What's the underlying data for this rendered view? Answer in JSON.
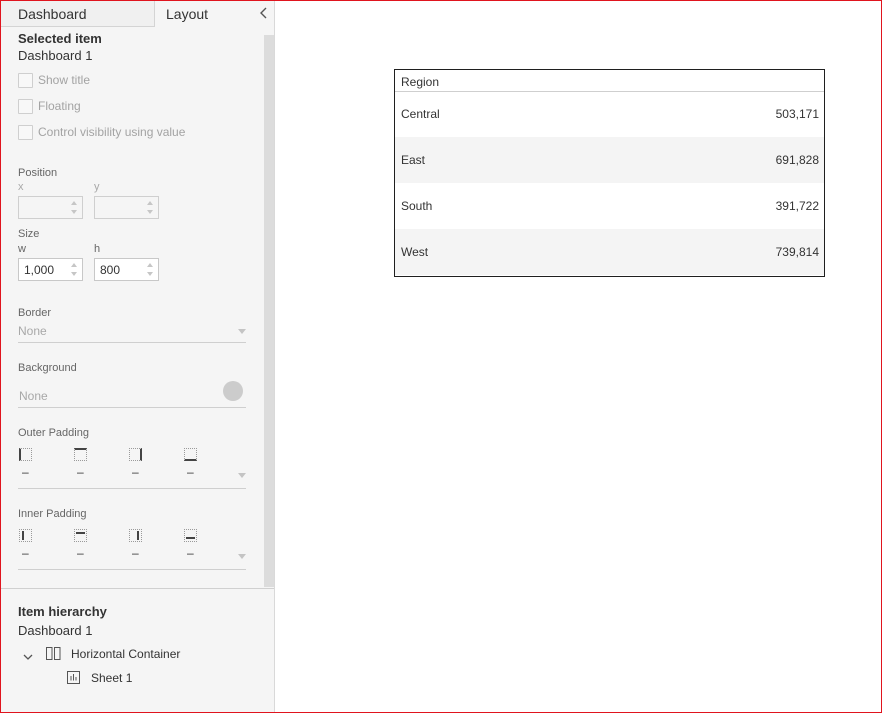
{
  "tabs": {
    "dashboard": "Dashboard",
    "layout": "Layout"
  },
  "selected_item": {
    "title": "Selected item",
    "name": "Dashboard 1",
    "checkboxes": [
      "Show title",
      "Floating",
      "Control visibility using value"
    ]
  },
  "position": {
    "label": "Position",
    "x_label": "x",
    "y_label": "y",
    "x_value": "",
    "y_value": ""
  },
  "size": {
    "label": "Size",
    "w_label": "w",
    "h_label": "h",
    "w_value": "1,000",
    "h_value": "800"
  },
  "border": {
    "label": "Border",
    "value": "None"
  },
  "background": {
    "label": "Background",
    "value": "None",
    "swatch_color": "#cccccc"
  },
  "outer_padding": {
    "label": "Outer Padding",
    "values": [
      "–",
      "–",
      "–",
      "–"
    ]
  },
  "inner_padding": {
    "label": "Inner Padding",
    "values": [
      "–",
      "–",
      "–",
      "–"
    ]
  },
  "item_hierarchy": {
    "title": "Item hierarchy",
    "root": "Dashboard 1",
    "container": "Horizontal Container",
    "sheet": "Sheet 1"
  },
  "table": {
    "header": "Region",
    "rows": [
      {
        "region": "Central",
        "value": "503,171"
      },
      {
        "region": "East",
        "value": "691,828"
      },
      {
        "region": "South",
        "value": "391,722"
      },
      {
        "region": "West",
        "value": "739,814"
      }
    ]
  },
  "colors": {
    "frame": "#e0141e",
    "panel_bg": "#f5f5f5",
    "alt_row": "#f4f4f4"
  }
}
